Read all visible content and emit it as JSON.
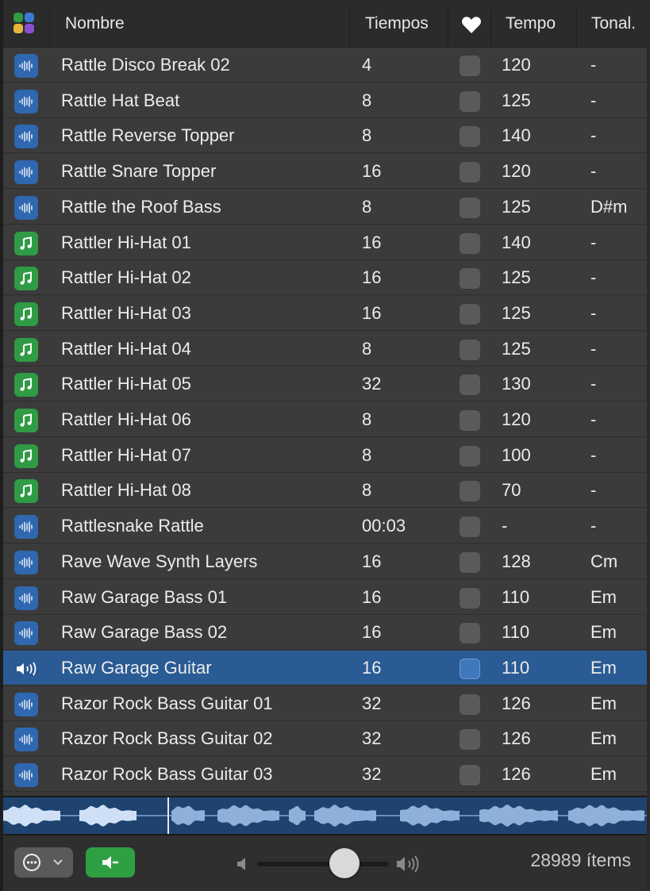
{
  "header": {
    "col_name": "Nombre",
    "col_beats": "Tiempos",
    "col_favorite_icon": "heart-icon",
    "col_tempo": "Tempo",
    "col_key": "Tonal."
  },
  "rows": [
    {
      "type": "audio",
      "name": "Rattle Disco Break 02",
      "beats": "4",
      "tempo": "120",
      "key": "-"
    },
    {
      "type": "audio",
      "name": "Rattle Hat Beat",
      "beats": "8",
      "tempo": "125",
      "key": "-"
    },
    {
      "type": "audio",
      "name": "Rattle Reverse Topper",
      "beats": "8",
      "tempo": "140",
      "key": "-"
    },
    {
      "type": "audio",
      "name": "Rattle Snare Topper",
      "beats": "16",
      "tempo": "120",
      "key": "-"
    },
    {
      "type": "audio",
      "name": "Rattle the Roof Bass",
      "beats": "8",
      "tempo": "125",
      "key": "D#m"
    },
    {
      "type": "midi",
      "name": "Rattler Hi-Hat 01",
      "beats": "16",
      "tempo": "140",
      "key": "-"
    },
    {
      "type": "midi",
      "name": "Rattler Hi-Hat 02",
      "beats": "16",
      "tempo": "125",
      "key": "-"
    },
    {
      "type": "midi",
      "name": "Rattler Hi-Hat 03",
      "beats": "16",
      "tempo": "125",
      "key": "-"
    },
    {
      "type": "midi",
      "name": "Rattler Hi-Hat 04",
      "beats": "8",
      "tempo": "125",
      "key": "-"
    },
    {
      "type": "midi",
      "name": "Rattler Hi-Hat 05",
      "beats": "32",
      "tempo": "130",
      "key": "-"
    },
    {
      "type": "midi",
      "name": "Rattler Hi-Hat 06",
      "beats": "8",
      "tempo": "120",
      "key": "-"
    },
    {
      "type": "midi",
      "name": "Rattler Hi-Hat 07",
      "beats": "8",
      "tempo": "100",
      "key": "-"
    },
    {
      "type": "midi",
      "name": "Rattler Hi-Hat 08",
      "beats": "8",
      "tempo": "70",
      "key": "-"
    },
    {
      "type": "audio",
      "name": "Rattlesnake Rattle",
      "beats": "00:03",
      "tempo": "-",
      "key": "-"
    },
    {
      "type": "audio",
      "name": "Rave Wave Synth Layers",
      "beats": "16",
      "tempo": "128",
      "key": "Cm"
    },
    {
      "type": "audio",
      "name": "Raw Garage Bass 01",
      "beats": "16",
      "tempo": "110",
      "key": "Em"
    },
    {
      "type": "audio",
      "name": "Raw Garage Bass 02",
      "beats": "16",
      "tempo": "110",
      "key": "Em"
    },
    {
      "type": "playing",
      "name": "Raw Garage Guitar",
      "beats": "16",
      "tempo": "110",
      "key": "Em",
      "selected": true
    },
    {
      "type": "audio",
      "name": "Razor Rock Bass Guitar 01",
      "beats": "32",
      "tempo": "126",
      "key": "Em"
    },
    {
      "type": "audio",
      "name": "Razor Rock Bass Guitar 02",
      "beats": "32",
      "tempo": "126",
      "key": "Em"
    },
    {
      "type": "audio",
      "name": "Razor Rock Bass Guitar 03",
      "beats": "32",
      "tempo": "126",
      "key": "Em"
    }
  ],
  "footer": {
    "more_icon": "ellipsis-circle-icon",
    "preview_icon": "speaker-icon",
    "volume_level": 0.66,
    "item_count": "28989 ítems"
  },
  "colors": {
    "audio_icon_bg": "#2f67b0",
    "midi_icon_bg": "#2f9b45",
    "selection": "#2a5b94",
    "preview_button": "#2ea043"
  }
}
